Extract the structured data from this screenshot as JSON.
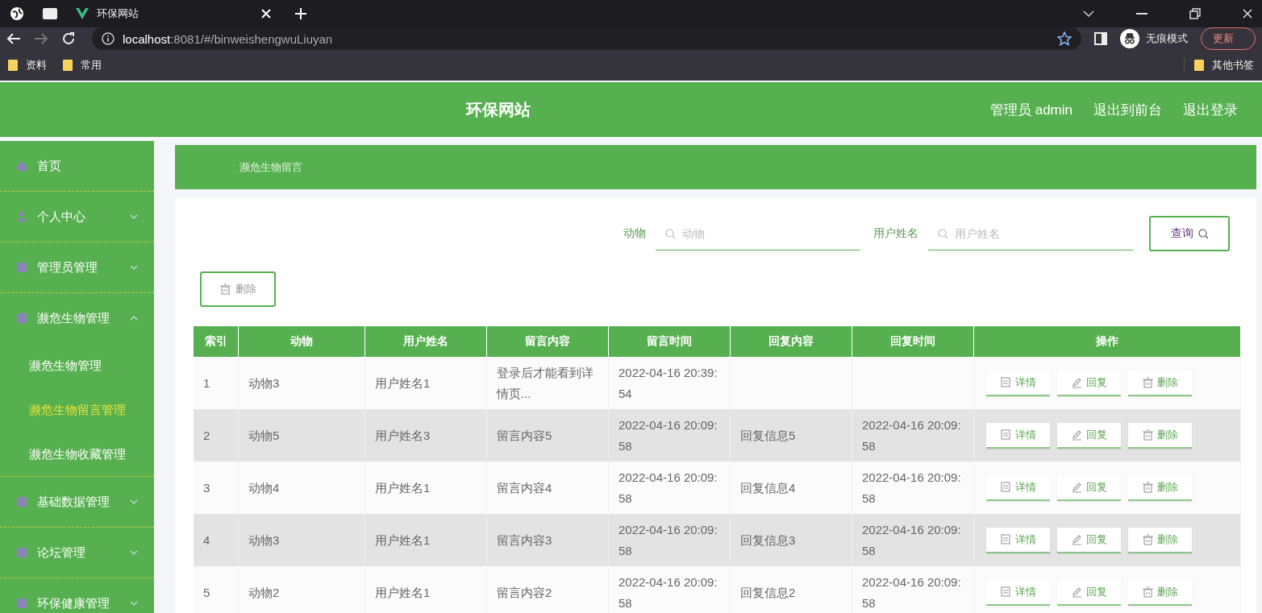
{
  "browser": {
    "tab_title": "环保网站",
    "url_host": "localhost",
    "url_rest": ":8081/#/binweishengwuLiuyan",
    "profile": "无痕模式",
    "update_button": "更新",
    "bookmarks": [
      "资料",
      "常用"
    ],
    "other_bookmarks": "其他书签"
  },
  "header": {
    "title": "环保网站",
    "user": "管理员 admin",
    "links": [
      "退出到前台",
      "退出登录"
    ]
  },
  "sidebar": {
    "items": [
      {
        "label": "首页",
        "kind": "link"
      },
      {
        "label": "个人中心",
        "kind": "group",
        "expanded": false
      },
      {
        "label": "管理员管理",
        "kind": "group",
        "expanded": false
      },
      {
        "label": "濒危生物管理",
        "kind": "group",
        "expanded": true,
        "children": [
          {
            "label": "濒危生物管理",
            "selected": false
          },
          {
            "label": "濒危生物留言管理",
            "selected": true
          },
          {
            "label": "濒危生物收藏管理",
            "selected": false
          }
        ]
      },
      {
        "label": "基础数据管理",
        "kind": "group",
        "expanded": false
      },
      {
        "label": "论坛管理",
        "kind": "group",
        "expanded": false
      },
      {
        "label": "环保健康管理",
        "kind": "group",
        "expanded": false
      }
    ]
  },
  "breadcrumb": "濒危生物留言",
  "search": {
    "fields": [
      {
        "label": "动物",
        "placeholder": "动物"
      },
      {
        "label": "用户姓名",
        "placeholder": "用户姓名"
      }
    ],
    "button": "查询"
  },
  "bulk_delete": "删除",
  "table": {
    "columns": [
      "索引",
      "动物",
      "用户姓名",
      "留言内容",
      "留言时间",
      "回复内容",
      "回复时间",
      "操作"
    ],
    "rows": [
      {
        "cells": [
          "1",
          "动物3",
          "用户姓名1",
          "登录后才能看到详情页...",
          "2022-04-16 20:39:54",
          "",
          ""
        ],
        "actions": [
          "详情",
          "回复",
          "删除"
        ]
      },
      {
        "cells": [
          "2",
          "动物5",
          "用户姓名3",
          "留言内容5",
          "2022-04-16 20:09:58",
          "回复信息5",
          "2022-04-16 20:09:58"
        ],
        "actions": [
          "详情",
          "回复",
          "删除"
        ]
      },
      {
        "cells": [
          "3",
          "动物4",
          "用户姓名1",
          "留言内容4",
          "2022-04-16 20:09:58",
          "回复信息4",
          "2022-04-16 20:09:58"
        ],
        "actions": [
          "详情",
          "回复",
          "删除"
        ]
      },
      {
        "cells": [
          "4",
          "动物3",
          "用户姓名1",
          "留言内容3",
          "2022-04-16 20:09:58",
          "回复信息3",
          "2022-04-16 20:09:58"
        ],
        "actions": [
          "详情",
          "回复",
          "删除"
        ]
      },
      {
        "cells": [
          "5",
          "动物2",
          "用户姓名1",
          "留言内容2",
          "2022-04-16 20:09:58",
          "回复信息2",
          "2022-04-16 20:09:58"
        ],
        "actions": [
          "详情",
          "回复",
          "删除"
        ]
      }
    ]
  }
}
